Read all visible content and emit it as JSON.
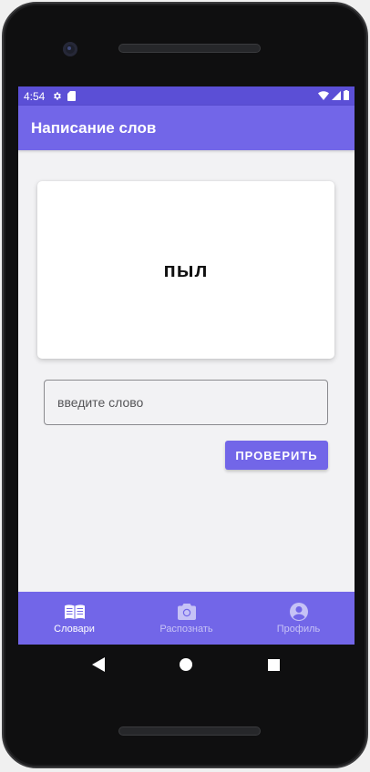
{
  "status_bar": {
    "time": "4:54",
    "left_icons": [
      "gear-icon",
      "sd-card-icon"
    ],
    "right_icons": [
      "wifi-icon",
      "signal-icon",
      "battery-icon"
    ]
  },
  "app_bar": {
    "title": "Написание слов"
  },
  "card": {
    "word": "пыл"
  },
  "answer_field": {
    "value": "",
    "placeholder": "введите слово"
  },
  "check_button": {
    "label": "ПРОВЕРИТЬ"
  },
  "bottom_nav": {
    "items": [
      {
        "label": "Словари",
        "icon": "book-icon",
        "active": true
      },
      {
        "label": "Распознать",
        "icon": "camera-icon",
        "active": false
      },
      {
        "label": "Профиль",
        "icon": "account-icon",
        "active": false
      }
    ]
  },
  "system_nav": [
    "back-icon",
    "home-icon",
    "recents-icon"
  ],
  "colors": {
    "status_bar": "#5b4fd6",
    "primary": "#7266e8",
    "background": "#f2f2f4"
  }
}
